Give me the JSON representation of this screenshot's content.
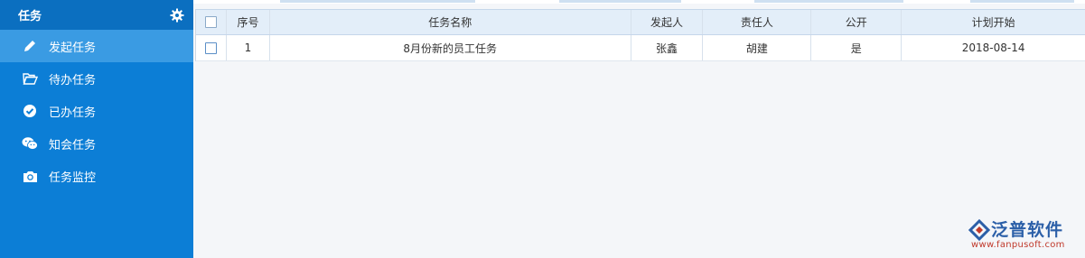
{
  "sidebar": {
    "title": "任务",
    "items": [
      {
        "label": "发起任务",
        "icon": "pencil-icon",
        "active": true
      },
      {
        "label": "待办任务",
        "icon": "folder-open-icon",
        "active": false
      },
      {
        "label": "已办任务",
        "icon": "check-circle-icon",
        "active": false
      },
      {
        "label": "知会任务",
        "icon": "wechat-icon",
        "active": false
      },
      {
        "label": "任务监控",
        "icon": "camera-icon",
        "active": false
      }
    ]
  },
  "table": {
    "columns": [
      "序号",
      "任务名称",
      "发起人",
      "责任人",
      "公开",
      "计划开始"
    ],
    "rows": [
      {
        "seq": "1",
        "name": "8月份新的员工任务",
        "initiator": "张鑫",
        "responsible": "胡建",
        "public": "是",
        "start": "2018-08-14"
      }
    ]
  },
  "logo": {
    "name": "泛普软件",
    "url": "www.fanpusoft.com"
  },
  "colors": {
    "sidebar": "#0c7ed6",
    "sidebar_active": "#3a9be3",
    "header_bg": "#e3eef9",
    "logo_blue": "#2b5fa8",
    "logo_red": "#c0392b"
  }
}
